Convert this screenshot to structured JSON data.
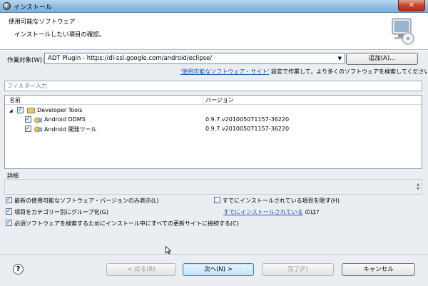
{
  "window": {
    "title": "インストール",
    "close_label": "✕"
  },
  "banner": {
    "title": "使用可能なソフトウェア",
    "description": "インストールしたい項目の確認。",
    "icon": "install-wizard-icon"
  },
  "work_with": {
    "label": "作業対象(W):",
    "value": "ADT Plugin - https://dl-ssl.google.com/android/eclipse/",
    "add_button": "追加(A)...",
    "info_link": "'使用可能なソフトウェア・サイト'",
    "info_text": " 設定で作業して，より多くのソフトウェアを検索してください。"
  },
  "filter": {
    "placeholder": "フィルター入力"
  },
  "tree": {
    "columns": {
      "name": "名前",
      "version": "バージョン"
    },
    "category": {
      "label": "Developer Tools",
      "checked": true,
      "expanded": true
    },
    "items": [
      {
        "label": "Android DDMS",
        "version": "0.9.7.v201005071157-36220",
        "checked": true
      },
      {
        "label": "Android 開発ツール",
        "version": "0.9.7.v201005071157-36220",
        "checked": true
      }
    ]
  },
  "details": {
    "label": "詳細"
  },
  "options": {
    "latest_only": "最新の使用可能なソフトウェア・バージョンのみ表示(L)",
    "hide_installed": "すでにインストールされている項目を隠す(H)",
    "group_by_category": "項目をカテゴリー別にグループ化(G)",
    "already_installed_link": "すでにインストールされている",
    "already_installed_suffix": " のは?",
    "contact_sites": "必須ソフトウェアを検索するためにインストール中にすべての更新サイトに接続する(C)",
    "latest_only_checked": true,
    "hide_installed_checked": false,
    "group_by_category_checked": true,
    "contact_sites_checked": true
  },
  "buttons": {
    "help": "?",
    "back": "< 戻る(B)",
    "next": "次へ(N) >",
    "finish": "完了(F)",
    "cancel": "キャンセル"
  }
}
